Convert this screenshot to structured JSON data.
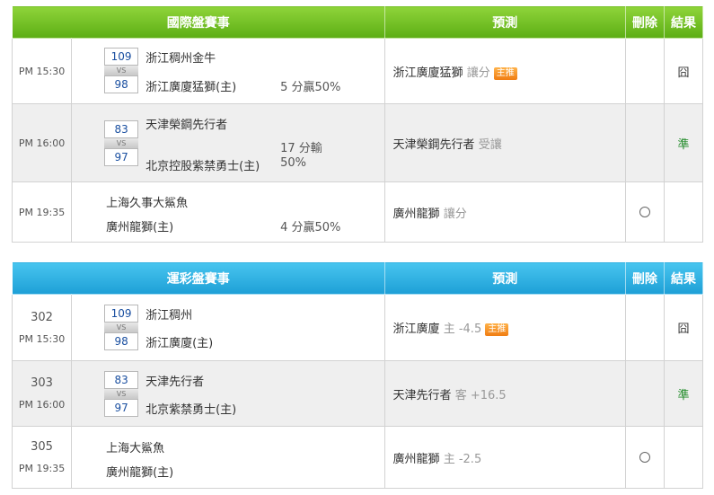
{
  "intl": {
    "header": {
      "title": "國際盤賽事",
      "pred": "預測",
      "del": "刪除",
      "res": "結果"
    },
    "rows": [
      {
        "time": "PM 15:30",
        "score_a": "109",
        "score_b": "98",
        "team_a": "浙江稠州金牛",
        "team_b": "浙江廣廈猛獅(主)",
        "odds_line1": "",
        "odds_line2": "5 分贏50%",
        "pick": "浙江廣廈猛獅",
        "pick_type": "讓分",
        "badge": "主推",
        "result": "囧"
      },
      {
        "time": "PM 16:00",
        "score_a": "83",
        "score_b": "97",
        "team_a": "天津榮鋼先行者",
        "team_b": "北京控股紫禁勇士(主)",
        "odds_line1": "17 分輸",
        "odds_line2": "50%",
        "pick": "天津榮鋼先行者",
        "pick_type": "受讓",
        "result": "準"
      },
      {
        "time": "PM 19:35",
        "team_a": "上海久事大鯊魚",
        "team_b": "廣州龍獅(主)",
        "odds_line2": "4 分贏50%",
        "pick": "廣州龍獅",
        "pick_type": "讓分"
      }
    ]
  },
  "lottery": {
    "header": {
      "title": "運彩盤賽事",
      "pred": "預測",
      "del": "刪除",
      "res": "結果"
    },
    "rows": [
      {
        "num": "302",
        "time": "PM 15:30",
        "score_a": "109",
        "score_b": "98",
        "team_a": "浙江稠州",
        "team_b": "浙江廣廈(主)",
        "pick": "浙江廣廈",
        "side": "主",
        "line": "-4.5",
        "badge": "主推",
        "result": "囧"
      },
      {
        "num": "303",
        "time": "PM 16:00",
        "score_a": "83",
        "score_b": "97",
        "team_a": "天津先行者",
        "team_b": "北京紫禁勇士(主)",
        "pick": "天津先行者",
        "side": "客",
        "line": "+16.5",
        "result": "準"
      },
      {
        "num": "305",
        "time": "PM 19:35",
        "team_a": "上海大鯊魚",
        "team_b": "廣州龍獅(主)",
        "pick": "廣州龍獅",
        "side": "主",
        "line": "-2.5"
      }
    ]
  },
  "vs_label": "VS",
  "colors": {
    "green_header": "#6cbf1e",
    "blue_header": "#29abe2",
    "badge": "#f5901e",
    "hit": "#1f8a27"
  }
}
